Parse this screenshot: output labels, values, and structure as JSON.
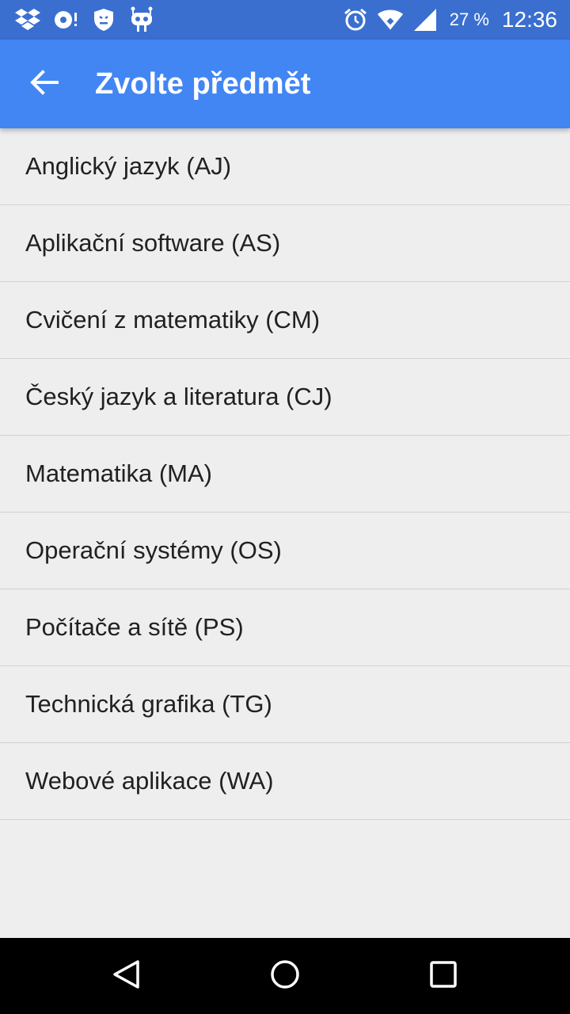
{
  "status_bar": {
    "battery": "27 %",
    "time": "12:36",
    "left_icons": [
      "dropbox-icon",
      "sync-icon",
      "shield-icon",
      "cyanogen-icon"
    ],
    "right_icons": [
      "alarm-icon",
      "wifi-icon",
      "signal-icon"
    ]
  },
  "app_bar": {
    "title": "Zvolte předmět",
    "back_icon": "arrow-back-icon"
  },
  "subjects": [
    {
      "label": "Anglický jazyk (AJ)"
    },
    {
      "label": "Aplikační software (AS)"
    },
    {
      "label": "Cvičení z matematiky (CM)"
    },
    {
      "label": "Český jazyk a literatura (CJ)"
    },
    {
      "label": "Matematika (MA)"
    },
    {
      "label": "Operační systémy (OS)"
    },
    {
      "label": "Počítače a sítě (PS)"
    },
    {
      "label": "Technická grafika (TG)"
    },
    {
      "label": "Webové aplikace (WA)"
    }
  ],
  "nav_bar": {
    "buttons": [
      "back-triangle-icon",
      "home-circle-icon",
      "recents-square-icon"
    ]
  },
  "colors": {
    "status_bar": "#3a6fd0",
    "app_bar": "#4286f4",
    "background": "#eeeeee",
    "text": "#212121",
    "divider": "#d2d2d2"
  }
}
